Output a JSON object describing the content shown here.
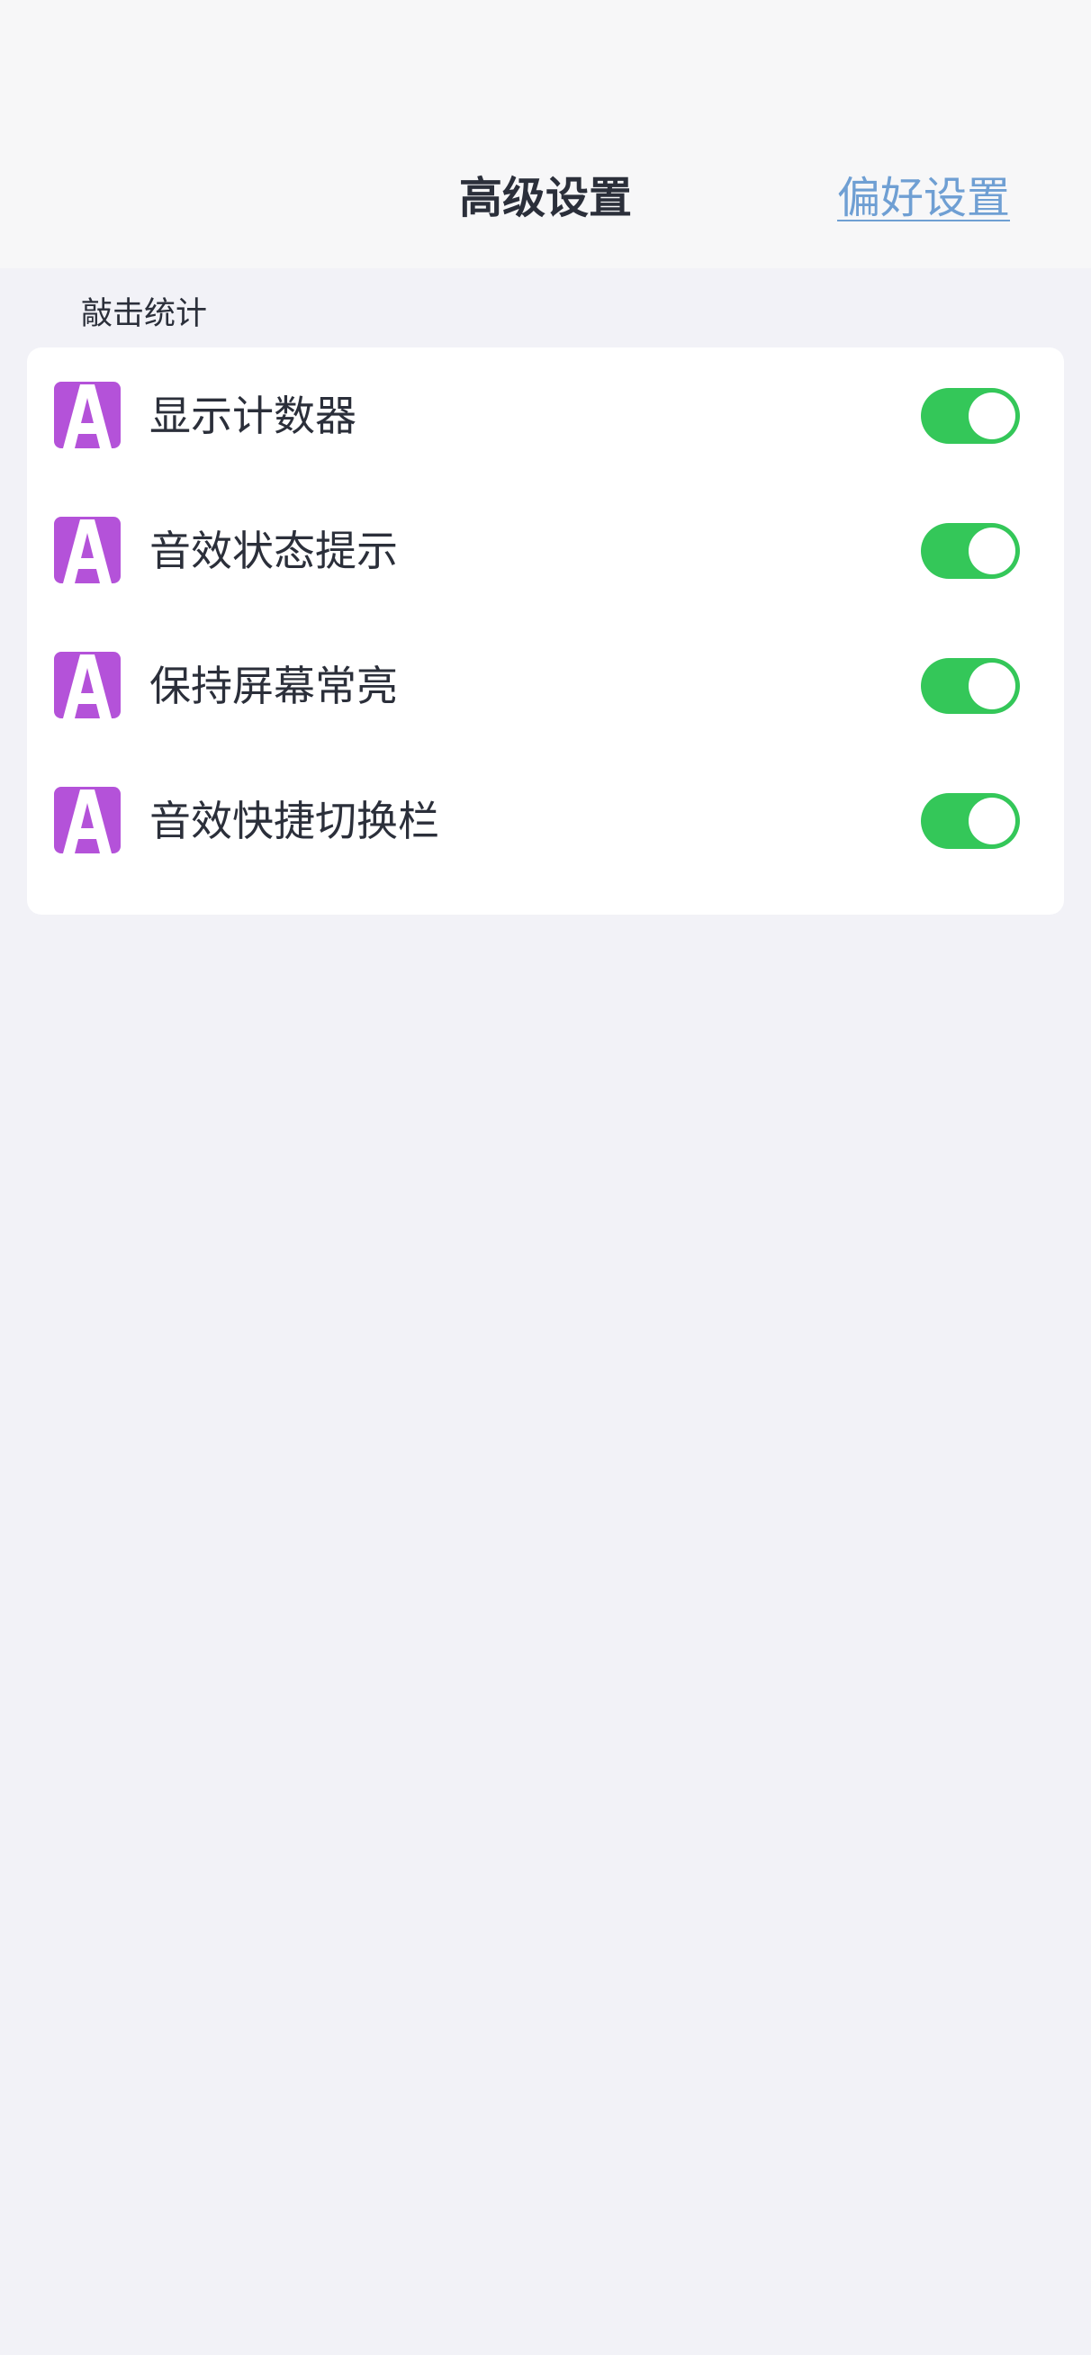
{
  "nav": {
    "title": "高级设置",
    "right_link": "偏好设置"
  },
  "section": {
    "header": "敲击统计"
  },
  "settings": [
    {
      "label": "显示计数器",
      "icon": "letter-a-icon",
      "enabled": true
    },
    {
      "label": "音效状态提示",
      "icon": "letter-a-icon",
      "enabled": true
    },
    {
      "label": "保持屏幕常亮",
      "icon": "letter-a-icon",
      "enabled": true
    },
    {
      "label": "音效快捷切换栏",
      "icon": "letter-a-icon",
      "enabled": true
    }
  ],
  "colors": {
    "accent_link": "#6f9fd3",
    "toggle_on": "#34c759",
    "icon_purple": "#b452d9",
    "background": "#f2f2f7"
  }
}
